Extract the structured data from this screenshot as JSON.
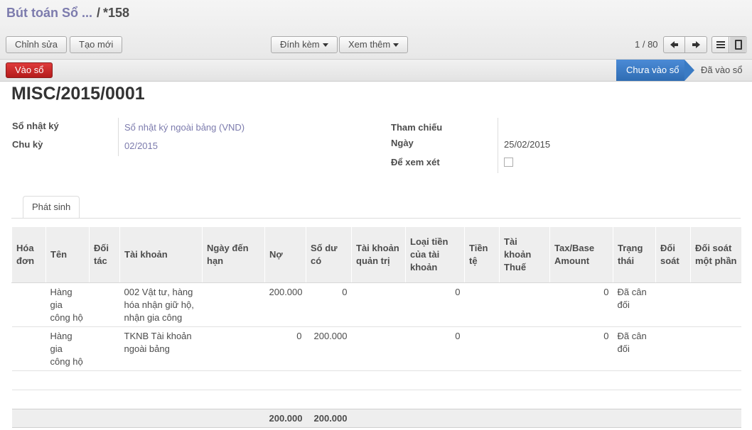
{
  "header": {
    "breadcrumb_parent": "Bút toán Sổ ...",
    "breadcrumb_sep": "/",
    "breadcrumb_current": "*158"
  },
  "toolbar": {
    "edit_label": "Chỉnh sửa",
    "create_label": "Tạo mới",
    "attach_label": "Đính kèm",
    "more_label": "Xem thêm"
  },
  "pager": {
    "text": "1 / 80"
  },
  "statusbar": {
    "post_label": "Vào sổ",
    "stages": [
      "Chưa vào sổ",
      "Đã vào sổ"
    ],
    "active_stage": "Chưa vào sổ"
  },
  "record": {
    "name": "MISC/2015/0001",
    "fields": {
      "journal_label": "Sổ nhật ký",
      "journal_value": "Sổ nhật ký ngoài bảng (VND)",
      "period_label": "Chu kỳ",
      "period_value": "02/2015",
      "ref_label": "Tham chiếu",
      "ref_value": "",
      "date_label": "Ngày",
      "date_value": "25/02/2015",
      "review_label": "Để xem xét",
      "review_checked": false
    }
  },
  "tabs": [
    "Phát sinh"
  ],
  "lines_table": {
    "columns": [
      "Hóa đơn",
      "Tên",
      "Đối tác",
      "Tài khoản",
      "Ngày đến hạn",
      "Nợ",
      "Số dư có",
      "Tài khoản quản trị",
      "Loại tiền của tài khoản",
      "Tiền tệ",
      "Tài khoản Thuế",
      "Tax/Base Amount",
      "Trạng thái",
      "Đối soát",
      "Đối soát một phần"
    ],
    "rows": [
      {
        "invoice": "",
        "name": "Hàng gia công hộ",
        "partner": "",
        "account": "002 Vật tư, hàng hóa nhận giữ hộ, nhận gia công",
        "due_date": "",
        "debit": "200.000",
        "credit": "0",
        "analytic": "",
        "amount_currency": "0",
        "currency": "",
        "tax_code": "",
        "tax_amount": "0",
        "state": "Đã cân đối",
        "reconcile": "",
        "reconcile_partial": ""
      },
      {
        "invoice": "",
        "name": "Hàng gia công hộ",
        "partner": "",
        "account": "TKNB Tài khoản ngoài bảng",
        "due_date": "",
        "debit": "0",
        "credit": "200.000",
        "analytic": "",
        "amount_currency": "0",
        "currency": "",
        "tax_code": "",
        "tax_amount": "0",
        "state": "Đã cân đối",
        "reconcile": "",
        "reconcile_partial": ""
      }
    ],
    "totals": {
      "debit": "200.000",
      "credit": "200.000"
    }
  }
}
